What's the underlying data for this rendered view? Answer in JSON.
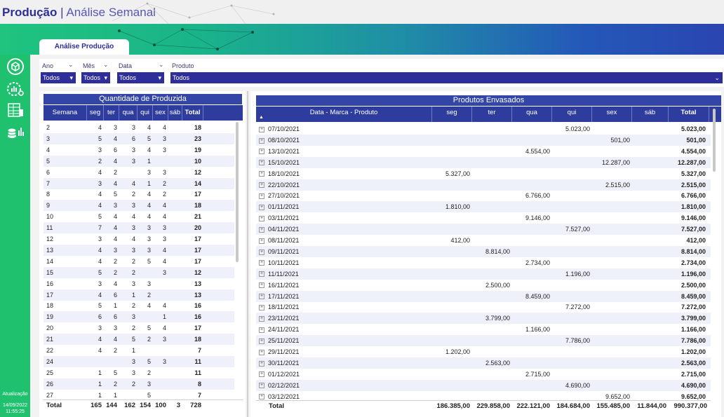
{
  "header": {
    "title_bold": "Produção",
    "title_sep": "|",
    "title_sub": "Análise  Semanal"
  },
  "tab": {
    "label": "Análise Produção"
  },
  "sidebar": {
    "icons": [
      "sync-cube-icon",
      "gear-chart-icon",
      "table-icon",
      "coins-chart-icon"
    ],
    "update_label": "Atualização",
    "update_date": "14/09/2022",
    "update_time": "11:55:25"
  },
  "filters": {
    "ano": {
      "label": "Ano",
      "value": "Todos"
    },
    "mes": {
      "label": "Mês",
      "value": "Todos"
    },
    "data": {
      "label": "Data",
      "value": "Todos"
    },
    "produto": {
      "label": "Produto",
      "value": "Todos"
    }
  },
  "left_table": {
    "title": "Quantidade de Produzida",
    "columns": [
      "Semana",
      "seg",
      "ter",
      "qua",
      "qui",
      "sex",
      "sáb",
      "Total"
    ],
    "rows": [
      [
        "2",
        "4",
        "3",
        "3",
        "4",
        "4",
        "",
        "18"
      ],
      [
        "3",
        "5",
        "4",
        "6",
        "5",
        "3",
        "",
        "23"
      ],
      [
        "4",
        "3",
        "6",
        "3",
        "4",
        "3",
        "",
        "19"
      ],
      [
        "5",
        "2",
        "4",
        "3",
        "1",
        "",
        "",
        "10"
      ],
      [
        "6",
        "4",
        "2",
        "",
        "3",
        "3",
        "",
        "12"
      ],
      [
        "7",
        "3",
        "4",
        "4",
        "1",
        "2",
        "",
        "14"
      ],
      [
        "8",
        "4",
        "5",
        "2",
        "4",
        "2",
        "",
        "17"
      ],
      [
        "9",
        "4",
        "3",
        "3",
        "4",
        "4",
        "",
        "18"
      ],
      [
        "10",
        "5",
        "4",
        "4",
        "4",
        "4",
        "",
        "21"
      ],
      [
        "11",
        "7",
        "4",
        "3",
        "3",
        "3",
        "",
        "20"
      ],
      [
        "12",
        "3",
        "4",
        "4",
        "3",
        "3",
        "",
        "17"
      ],
      [
        "13",
        "4",
        "3",
        "3",
        "3",
        "4",
        "",
        "17"
      ],
      [
        "14",
        "4",
        "2",
        "2",
        "5",
        "4",
        "",
        "17"
      ],
      [
        "15",
        "5",
        "2",
        "2",
        "",
        "3",
        "",
        "12"
      ],
      [
        "16",
        "3",
        "4",
        "3",
        "3",
        "",
        "",
        "13"
      ],
      [
        "17",
        "4",
        "6",
        "1",
        "2",
        "",
        "",
        "13"
      ],
      [
        "18",
        "5",
        "1",
        "2",
        "4",
        "4",
        "",
        "16"
      ],
      [
        "19",
        "6",
        "6",
        "3",
        "",
        "1",
        "",
        "16"
      ],
      [
        "20",
        "3",
        "3",
        "2",
        "5",
        "4",
        "",
        "17"
      ],
      [
        "21",
        "4",
        "4",
        "5",
        "2",
        "3",
        "",
        "18"
      ],
      [
        "22",
        "4",
        "2",
        "1",
        "",
        "",
        "",
        "7"
      ],
      [
        "24",
        "",
        "",
        "3",
        "5",
        "3",
        "",
        "11"
      ],
      [
        "25",
        "1",
        "5",
        "3",
        "2",
        "",
        "",
        "11"
      ],
      [
        "26",
        "1",
        "2",
        "2",
        "3",
        "",
        "",
        "8"
      ],
      [
        "27",
        "1",
        "1",
        "",
        "5",
        "",
        "",
        "7"
      ]
    ],
    "total": [
      "Total",
      "165",
      "144",
      "162",
      "154",
      "100",
      "3",
      "728"
    ]
  },
  "right_table": {
    "title": "Produtos Envasados",
    "columns": [
      "Data - Marca - Produto",
      "seg",
      "ter",
      "qua",
      "qui",
      "sex",
      "sáb",
      "Total"
    ],
    "sort_indicator": "▲",
    "rows": [
      [
        "07/10/2021",
        "",
        "",
        "",
        "5.023,00",
        "",
        "",
        "5.023,00"
      ],
      [
        "08/10/2021",
        "",
        "",
        "",
        "",
        "501,00",
        "",
        "501,00"
      ],
      [
        "13/10/2021",
        "",
        "",
        "4.554,00",
        "",
        "",
        "",
        "4.554,00"
      ],
      [
        "15/10/2021",
        "",
        "",
        "",
        "",
        "12.287,00",
        "",
        "12.287,00"
      ],
      [
        "18/10/2021",
        "5.327,00",
        "",
        "",
        "",
        "",
        "",
        "5.327,00"
      ],
      [
        "22/10/2021",
        "",
        "",
        "",
        "",
        "2.515,00",
        "",
        "2.515,00"
      ],
      [
        "27/10/2021",
        "",
        "",
        "6.766,00",
        "",
        "",
        "",
        "6.766,00"
      ],
      [
        "01/11/2021",
        "1.810,00",
        "",
        "",
        "",
        "",
        "",
        "1.810,00"
      ],
      [
        "03/11/2021",
        "",
        "",
        "9.146,00",
        "",
        "",
        "",
        "9.146,00"
      ],
      [
        "04/11/2021",
        "",
        "",
        "",
        "7.527,00",
        "",
        "",
        "7.527,00"
      ],
      [
        "08/11/2021",
        "412,00",
        "",
        "",
        "",
        "",
        "",
        "412,00"
      ],
      [
        "09/11/2021",
        "",
        "8.814,00",
        "",
        "",
        "",
        "",
        "8.814,00"
      ],
      [
        "10/11/2021",
        "",
        "",
        "2.734,00",
        "",
        "",
        "",
        "2.734,00"
      ],
      [
        "11/11/2021",
        "",
        "",
        "",
        "1.196,00",
        "",
        "",
        "1.196,00"
      ],
      [
        "16/11/2021",
        "",
        "2.500,00",
        "",
        "",
        "",
        "",
        "2.500,00"
      ],
      [
        "17/11/2021",
        "",
        "",
        "8.459,00",
        "",
        "",
        "",
        "8.459,00"
      ],
      [
        "18/11/2021",
        "",
        "",
        "",
        "7.272,00",
        "",
        "",
        "7.272,00"
      ],
      [
        "23/11/2021",
        "",
        "3.799,00",
        "",
        "",
        "",
        "",
        "3.799,00"
      ],
      [
        "24/11/2021",
        "",
        "",
        "1.166,00",
        "",
        "",
        "",
        "1.166,00"
      ],
      [
        "25/11/2021",
        "",
        "",
        "",
        "7.786,00",
        "",
        "",
        "7.786,00"
      ],
      [
        "29/11/2021",
        "1.202,00",
        "",
        "",
        "",
        "",
        "",
        "1.202,00"
      ],
      [
        "30/11/2021",
        "",
        "2.563,00",
        "",
        "",
        "",
        "",
        "2.563,00"
      ],
      [
        "01/12/2021",
        "",
        "",
        "2.715,00",
        "",
        "",
        "",
        "2.715,00"
      ],
      [
        "02/12/2021",
        "",
        "",
        "",
        "4.690,00",
        "",
        "",
        "4.690,00"
      ],
      [
        "03/12/2021",
        "",
        "",
        "",
        "",
        "9.652,00",
        "",
        "9.652,00"
      ]
    ],
    "total": [
      "Total",
      "186.385,00",
      "229.858,00",
      "222.121,00",
      "184.684,00",
      "155.485,00",
      "11.844,00",
      "990.377,00"
    ]
  },
  "colors": {
    "brand_blue": "#2e2e9a",
    "header_blue": "#2e3c9e",
    "sidebar_green": "#1fc06e",
    "row_alt": "#eef0fa"
  }
}
